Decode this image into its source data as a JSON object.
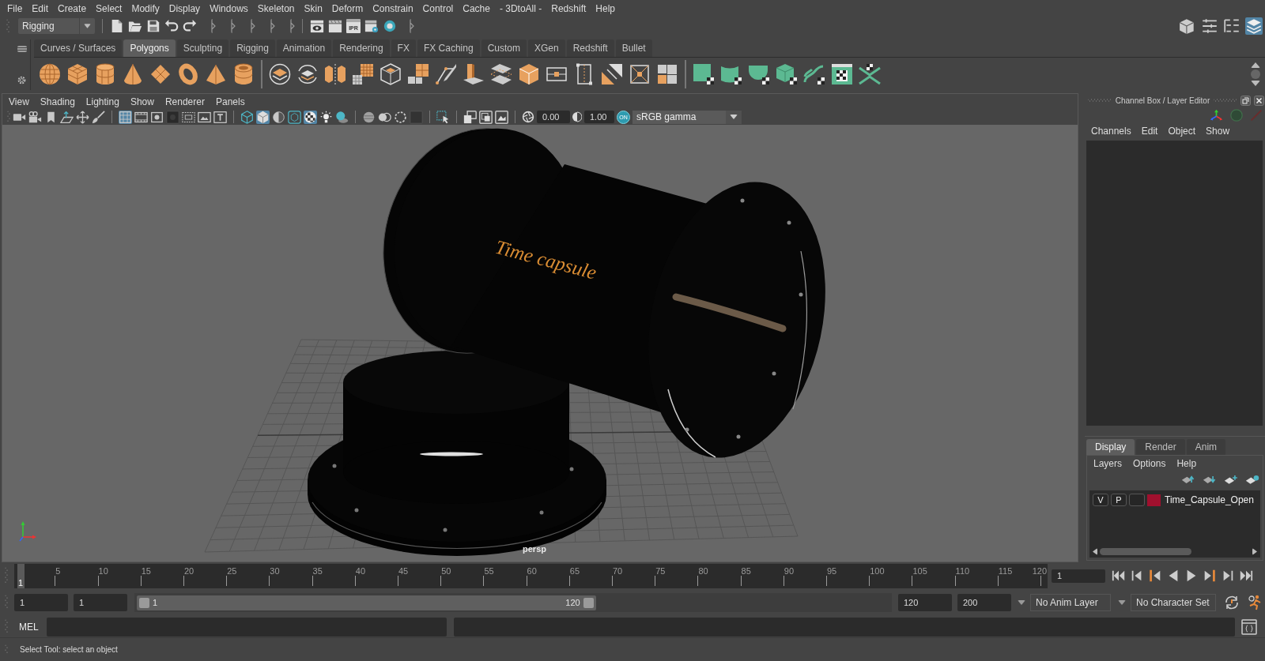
{
  "menu_bar": [
    "File",
    "Edit",
    "Create",
    "Select",
    "Modify",
    "Display",
    "Windows",
    "Skeleton",
    "Skin",
    "Deform",
    "Constrain",
    "Control",
    "Cache",
    "- 3DtoAll -",
    "Redshift",
    "Help"
  ],
  "status_line": {
    "menu_set": "Rigging",
    "ipr_label": "IPR",
    "panel_toggles": [
      {
        "on": false
      },
      {
        "on": false
      },
      {
        "on": false
      },
      {
        "on": true
      }
    ]
  },
  "shelf": {
    "tabs": [
      {
        "label": "Curves / Surfaces",
        "selected": false
      },
      {
        "label": "Polygons",
        "selected": true
      },
      {
        "label": "Sculpting",
        "selected": false
      },
      {
        "label": "Rigging",
        "selected": false
      },
      {
        "label": "Animation",
        "selected": false
      },
      {
        "label": "Rendering",
        "selected": false
      },
      {
        "label": "FX",
        "selected": false
      },
      {
        "label": "FX Caching",
        "selected": false
      },
      {
        "label": "Custom",
        "selected": false
      },
      {
        "label": "XGen",
        "selected": false
      },
      {
        "label": "Redshift",
        "selected": false
      },
      {
        "label": "Bullet",
        "selected": false
      }
    ]
  },
  "viewport": {
    "menu": [
      "View",
      "Shading",
      "Lighting",
      "Show",
      "Renderer",
      "Panels"
    ],
    "toolbar": [
      {
        "on": false
      },
      {
        "on": false
      },
      {
        "on": false
      },
      {
        "on": false
      },
      {
        "on": false
      },
      {
        "on": false
      },
      {
        "on": true
      },
      {
        "on": false
      },
      {
        "on": false
      },
      {
        "on": false
      },
      {
        "on": false
      },
      {
        "on": false
      },
      {
        "on": false
      },
      {
        "on": false
      },
      {
        "on": true
      },
      {
        "on": false
      },
      {
        "on": false
      },
      {
        "on": true
      },
      {
        "on": false
      },
      {
        "on": false
      },
      {
        "on": false
      },
      {
        "on": false
      },
      {
        "on": false
      },
      {
        "on": false
      },
      {
        "on": false
      },
      {
        "on": false
      },
      {
        "on": false
      },
      {
        "on": false
      }
    ],
    "exposure": "0.00",
    "gamma": "1.00",
    "view_transform": {
      "label": "ON",
      "on": true
    },
    "color_space": "sRGB gamma",
    "model_label": "Time capsule",
    "camera": "persp"
  },
  "channel_box": {
    "title": "Channel Box / Layer Editor",
    "menu": [
      "Channels",
      "Edit",
      "Object",
      "Show"
    ]
  },
  "layer_editor": {
    "tabs": [
      {
        "label": "Display",
        "selected": true
      },
      {
        "label": "Render",
        "selected": false
      },
      {
        "label": "Anim",
        "selected": false
      }
    ],
    "menu": [
      "Layers",
      "Options",
      "Help"
    ],
    "layers": [
      {
        "visibility": "V",
        "playback": "P",
        "color": "#a0102e",
        "name": "Time_Capsule_Open"
      }
    ]
  },
  "time_slider": {
    "ticks": [
      "5",
      "10",
      "15",
      "20",
      "25",
      "30",
      "35",
      "40",
      "45",
      "50",
      "55",
      "60",
      "65",
      "70",
      "75",
      "80",
      "85",
      "90",
      "95",
      "100",
      "105",
      "110",
      "115",
      "120"
    ],
    "current_frame": "1",
    "level": 0,
    "frame_field": "1"
  },
  "range_slider": {
    "start_time": "1",
    "playback_start": "1",
    "start_label": "1",
    "end_label": "120",
    "level": 0.61,
    "playback_end": "120",
    "end_time": "200"
  },
  "anim_layer": "No Anim Layer",
  "character_set": "No Character Set",
  "command_line": {
    "language": "MEL"
  },
  "help_line": "Select Tool: select an object"
}
